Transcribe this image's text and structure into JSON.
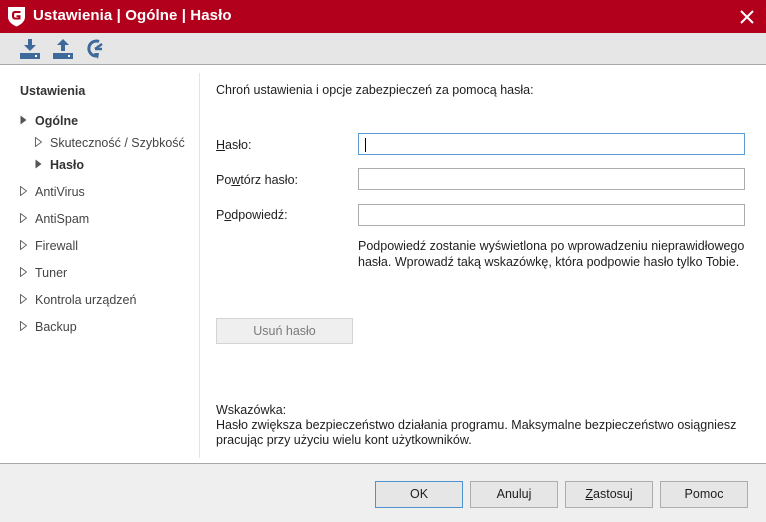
{
  "window": {
    "title": "Ustawienia | Ogólne | Hasło",
    "logo_icon": "gdata-shield-logo-icon",
    "close_icon": "close-icon",
    "brand_color": "#b2001c"
  },
  "toolbar": {
    "buttons": [
      {
        "name": "import-settings",
        "icon": "download-icon"
      },
      {
        "name": "export-settings",
        "icon": "upload-icon"
      },
      {
        "name": "restore-defaults",
        "icon": "restore-icon"
      }
    ],
    "icon_color": "#3d6a9a"
  },
  "sidebar": {
    "heading": "Ustawienia",
    "items": [
      {
        "label": "Ogólne",
        "level": 0,
        "expanded": true,
        "bold": true
      },
      {
        "label": "Skuteczność / Szybkość",
        "level": 1,
        "expanded": false,
        "bold": false
      },
      {
        "label": "Hasło",
        "level": 1,
        "expanded": false,
        "bold": true,
        "selected": true
      },
      {
        "label": "AntiVirus",
        "level": 0,
        "expanded": false,
        "bold": false
      },
      {
        "label": "AntiSpam",
        "level": 0,
        "expanded": false,
        "bold": false
      },
      {
        "label": "Firewall",
        "level": 0,
        "expanded": false,
        "bold": false
      },
      {
        "label": "Tuner",
        "level": 0,
        "expanded": false,
        "bold": false
      },
      {
        "label": "Kontrola urządzeń",
        "level": 0,
        "expanded": false,
        "bold": false
      },
      {
        "label": "Backup",
        "level": 0,
        "expanded": false,
        "bold": false
      }
    ]
  },
  "main": {
    "intro": "Chroń ustawienia i opcje zabezpieczeń za pomocą hasła:",
    "fields": [
      {
        "label_pre": "",
        "label_mnemonic": "H",
        "label_post": "asło:",
        "value": "",
        "focused": true
      },
      {
        "label_pre": "Po",
        "label_mnemonic": "w",
        "label_post": "tórz hasło:",
        "value": "",
        "focused": false
      },
      {
        "label_pre": "P",
        "label_mnemonic": "o",
        "label_post": "dpowiedź:",
        "value": "",
        "focused": false
      }
    ],
    "hint_line1": "Podpowiedź zostanie wyświetlona po wprowadzeniu nieprawidłowego",
    "hint_line2": "hasła. Wprowadź taką wskazówkę, która podpowie hasło tylko Tobie.",
    "remove_button": "Usuń hasło",
    "tip_heading": "Wskazówka:",
    "tip_line1": "Hasło zwiększa bezpieczeństwo działania programu. Maksymalne bezpieczeństwo osiągniesz",
    "tip_line2": "pracując przy użyciu wielu kont użytkowników."
  },
  "footer": {
    "ok": "OK",
    "cancel": "Anuluj",
    "apply_mnemonic": "Z",
    "apply_rest": "astosuj",
    "help": "Pomoc"
  }
}
